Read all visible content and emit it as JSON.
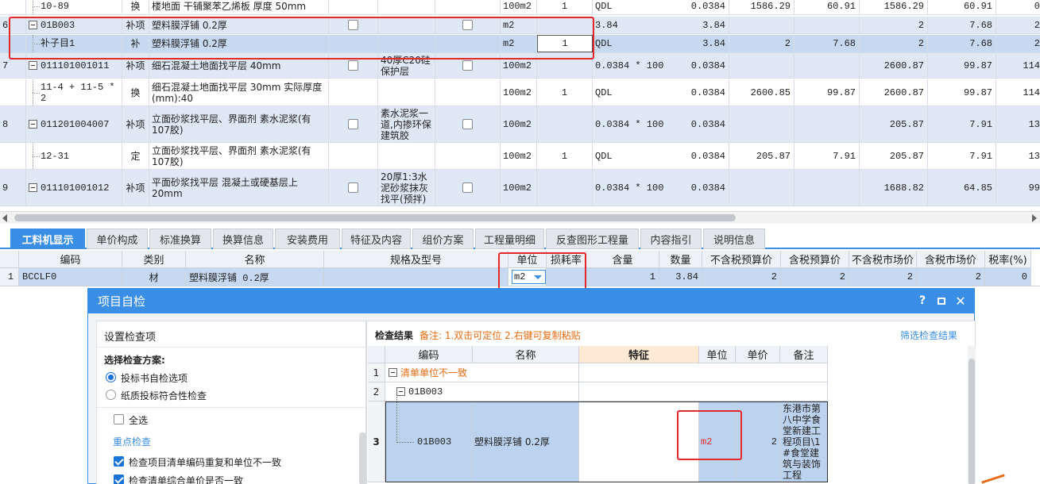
{
  "top_rows": [
    {
      "no": "",
      "code": "10-89",
      "type": "换",
      "name": "楼地面 干铺聚苯乙烯板 厚度 50mm",
      "feature": "",
      "unit": "100m2",
      "qty": "1",
      "expr": "QDL",
      "amount": "0.0384",
      "p1": "1586.29",
      "p2": "60.91",
      "p3": "1586.29",
      "p4": "60.91",
      "p5": "0"
    },
    {
      "no": "6",
      "code": "01B003",
      "type": "补项",
      "name": "塑料膜浮铺 0.2厚",
      "feature": "",
      "unit": "m2",
      "qty": "",
      "expr": "3.84",
      "amount": "3.84",
      "p1": "",
      "p2": "",
      "p3": "2",
      "p4": "7.68",
      "p5": "2"
    },
    {
      "no": "",
      "code": "补子目1",
      "type": "补",
      "name": "塑料膜浮铺 0.2厚",
      "feature": "",
      "unit": "m2",
      "qty": "1",
      "expr": "QDL",
      "amount": "3.84",
      "p1": "2",
      "p2": "7.68",
      "p3": "2",
      "p4": "7.68",
      "p5": "2"
    },
    {
      "no": "7",
      "code": "011101001011",
      "type": "补项",
      "name": "细石混凝土地面找平层 40mm",
      "feature": "40厚C20硅保护层",
      "unit": "100m2",
      "qty": "",
      "expr": "0.0384 * 100",
      "amount": "0.0384",
      "p1": "",
      "p2": "",
      "p3": "2600.87",
      "p4": "99.87",
      "p5": "114"
    },
    {
      "no": "",
      "code": "11-4 + 11-5 * 2",
      "type": "换",
      "name": "细石混凝土地面找平层 30mm  实际厚度(mm):40",
      "feature": "",
      "unit": "100m2",
      "qty": "1",
      "expr": "QDL",
      "amount": "0.0384",
      "p1": "2600.85",
      "p2": "99.87",
      "p3": "2600.87",
      "p4": "99.87",
      "p5": "114"
    },
    {
      "no": "8",
      "code": "011201004007",
      "type": "补项",
      "name": "立面砂浆找平层、界面剂 素水泥浆(有107胶)",
      "feature": "素水泥浆一道,内掺环保建筑胶",
      "unit": "100m2",
      "qty": "",
      "expr": "0.0384 * 100",
      "amount": "0.0384",
      "p1": "",
      "p2": "",
      "p3": "205.87",
      "p4": "7.91",
      "p5": "13"
    },
    {
      "no": "",
      "code": "12-31",
      "type": "定",
      "name": "立面砂浆找平层、界面剂 素水泥浆(有107胶)",
      "feature": "",
      "unit": "100m2",
      "qty": "1",
      "expr": "QDL",
      "amount": "0.0384",
      "p1": "205.87",
      "p2": "7.91",
      "p3": "205.87",
      "p4": "7.91",
      "p5": "13"
    },
    {
      "no": "9",
      "code": "011101001012",
      "type": "补项",
      "name": "平面砂浆找平层 混凝土或硬基层上 20mm",
      "feature": "20厚1:3水泥砂浆抹灰找平(预拌)",
      "unit": "100m2",
      "qty": "",
      "expr": "0.0384 * 100",
      "amount": "0.0384",
      "p1": "",
      "p2": "",
      "p3": "1688.82",
      "p4": "64.85",
      "p5": "99"
    }
  ],
  "tabs": [
    "工料机显示",
    "单价构成",
    "标准换算",
    "换算信息",
    "安装费用",
    "特征及内容",
    "组价方案",
    "工程量明细",
    "反查图形工程量",
    "内容指引",
    "说明信息"
  ],
  "lower_headers": [
    "编码",
    "类别",
    "名称",
    "规格及型号",
    "单位",
    "损耗率",
    "含量",
    "数量",
    "不含税预算价",
    "含税预算价",
    "不含税市场价",
    "含税市场价",
    "税率(%)"
  ],
  "lower_row": {
    "no": "1",
    "code": "BCCLF0",
    "type": "材",
    "name": "塑料膜浮铺 0.2厚",
    "spec": "",
    "unit": "m2",
    "loss": "",
    "content": "1",
    "qty": "3.84",
    "p1": "2",
    "p2": "2",
    "p3": "2",
    "p4": "2",
    "tax": "0"
  },
  "dialog": {
    "title": "项目自检",
    "left_title": "设置检查项",
    "scheme_label": "选择检查方案:",
    "radio1": "投标书自检选项",
    "radio2": "纸质投标符合性检查",
    "select_all": "全选",
    "key_check": "重点检查",
    "check1": "检查项目清单编码重复和单位不一致",
    "check2": "检查清单综合单价是否一致",
    "result_title": "检查结果",
    "result_note": "备注: 1.双击可定位 2.右键可复制粘贴",
    "filter_link": "筛选检查结果",
    "headers": [
      "编码",
      "名称",
      "特征",
      "单位",
      "单价",
      "备注"
    ],
    "row1_no": "1",
    "row1_text": "清单单位不一致",
    "row2_no": "2",
    "row2_code": "01B003",
    "row3_no": "3",
    "row3_code": "01B003",
    "row3_name": "塑料膜浮铺 0.2厚",
    "row3_feature": "",
    "row3_unit": "m2",
    "row3_price": "2",
    "row3_note": "东港市第八中学食堂新建工程项目\\1#食堂建筑与装饰工程"
  },
  "colors": {
    "accent": "#3a8ee6",
    "highlight": "#e5282a",
    "orange": "#e96a10"
  }
}
